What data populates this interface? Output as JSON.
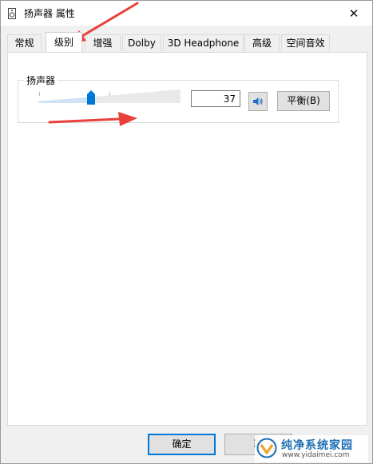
{
  "window": {
    "title": "扬声器 属性"
  },
  "tabs": [
    {
      "label": "常规",
      "active": false
    },
    {
      "label": "级别",
      "active": true
    },
    {
      "label": "增强",
      "active": false
    },
    {
      "label": "Dolby",
      "active": false
    },
    {
      "label": "3D Headphone",
      "active": false
    },
    {
      "label": "高级",
      "active": false
    },
    {
      "label": "空间音效",
      "active": false
    }
  ],
  "levels": {
    "group_label": "扬声器",
    "volume_value": "37",
    "volume_level_fraction": 0.37,
    "mute_icon": "speaker-icon",
    "balance_label": "平衡(B)"
  },
  "buttons": {
    "ok": "确定",
    "cancel": "取"
  },
  "watermark": {
    "title": "纯净系统家园",
    "url": "www.yidaimei.com"
  },
  "colors": {
    "accent": "#0078d7",
    "annotation_arrow": "#e8403a",
    "slider_fill": "#cfe3f5"
  }
}
